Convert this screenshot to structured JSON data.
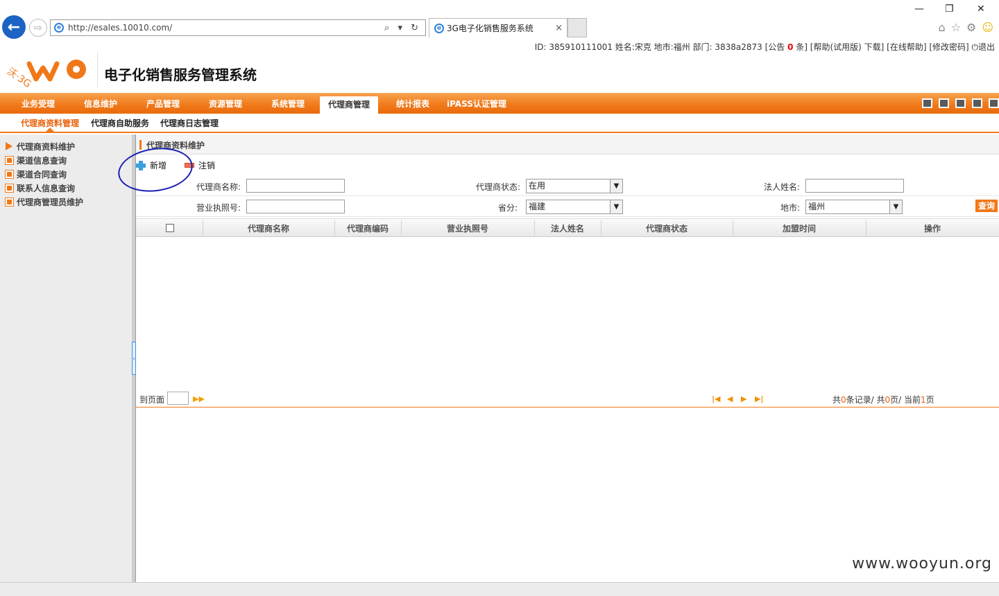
{
  "browser": {
    "url": "http://esales.10010.com/",
    "tab_title": "3G电子化销售服务系统",
    "tab_close": "×",
    "back_glyph": "←",
    "forward_glyph": "⇨",
    "address_tools": "⌕ ▾ ↻",
    "ie_glyph": "e",
    "window_controls": [
      "—",
      "❐",
      "✕"
    ],
    "toolbar_icons": [
      "home-icon",
      "star-icon",
      "gear-icon",
      "smiley-icon"
    ],
    "toolbar_glyphs": [
      "⌂",
      "☆",
      "⚙",
      "☺"
    ]
  },
  "userinfo": {
    "prefix": "ID: 385910111001 姓名:宋克 地市:福州 部门: 3838a2873 [公告 ",
    "notice_count": "0",
    "suffix": " 条] [帮助(试用版) 下载] [在线帮助] [修改密码] ⏻退出"
  },
  "header": {
    "logo_text": "沃·3G",
    "system_title": "电子化销售服务管理系统"
  },
  "main_nav": {
    "items": [
      "业务受理",
      "信息维护",
      "产品管理",
      "资源管理",
      "系统管理",
      "代理商管理",
      "统计报表",
      "iPASS认证管理"
    ],
    "active": "代理商管理"
  },
  "sub_nav": {
    "items": [
      "代理商资料管理",
      "代理商自助服务",
      "代理商日志管理"
    ],
    "active": "代理商资料管理"
  },
  "sidebar": {
    "items": [
      "代理商资料维护",
      "渠道信息查询",
      "渠道合同查询",
      "联系人信息查询",
      "代理商管理员维护"
    ],
    "active": "代理商资料维护",
    "collapse_glyph": "‹"
  },
  "panel": {
    "title": "代理商资料维护",
    "toolbar": {
      "add": "新增",
      "cancel": "注销"
    }
  },
  "search_form": {
    "name_label": "代理商名称:",
    "name_value": "",
    "status_label": "代理商状态:",
    "status_value": "在用",
    "legal_label": "法人姓名:",
    "legal_value": "",
    "license_label": "营业执照号:",
    "license_value": "",
    "province_label": "省分:",
    "province_value": "福建",
    "city_label": "地市:",
    "city_value": "福州",
    "query_button": "查询",
    "dropdown_glyph": "▼"
  },
  "table": {
    "headers": [
      "代理商名称",
      "代理商编码",
      "营业执照号",
      "法人姓名",
      "代理商状态",
      "加盟时间",
      "操作"
    ],
    "rows": []
  },
  "pager": {
    "goto_label": "到页面",
    "goto_value": "",
    "go_glyph": "▶▶",
    "first": "|◀",
    "prev": "◀",
    "next": "▶",
    "last": "▶|",
    "info_prefix": "共",
    "total_records": "0",
    "info_mid1": "条记录/ 共",
    "total_pages": "0",
    "info_mid2": "页/ 当前",
    "current_page": "1",
    "info_suffix": "页"
  },
  "watermark": "www.wooyun.org",
  "colors": {
    "accent": "#f07818",
    "browser_blue": "#1c63c3",
    "annotation": "#1a1fb0"
  }
}
